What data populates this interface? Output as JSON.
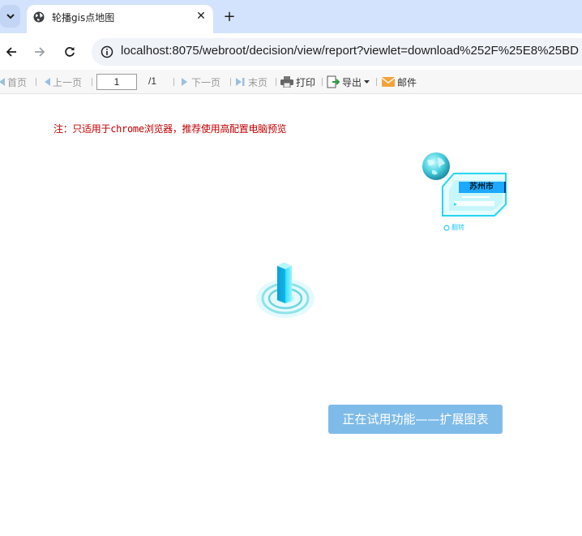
{
  "browser": {
    "tab_title": "轮播gis点地图",
    "url": "localhost:8075/webroot/decision/view/report?viewlet=download%252F%25E8%25BD"
  },
  "toolbar": {
    "first": "首页",
    "prev": "上一页",
    "page_value": "1",
    "page_total": "/1",
    "next": "下一页",
    "last": "末页",
    "print": "打印",
    "export": "导出",
    "mail": "邮件"
  },
  "report": {
    "note": "注：只适用于chrome浏览器，推荐使用高配置电脑预览",
    "city_label": "苏州市",
    "card_footer": "翻转",
    "trial_banner": "正在试用功能——扩展图表"
  },
  "icons": [
    "tab-search-icon",
    "globe-favicon-icon",
    "close-icon",
    "plus-icon",
    "back-icon",
    "forward-icon",
    "reload-icon",
    "info-icon",
    "first-page-icon",
    "prev-page-icon",
    "next-page-icon",
    "last-page-icon",
    "printer-icon",
    "export-icon",
    "mail-icon"
  ],
  "colors": {
    "note": "#c00000",
    "tabstrip": "#d3e3fd",
    "trial": "#7fbbe8",
    "city_tag": "#1da9ff"
  }
}
